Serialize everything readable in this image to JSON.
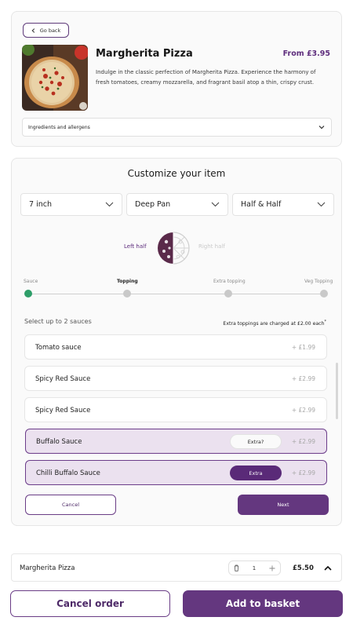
{
  "product": {
    "back_label": "Go back",
    "title": "Margherita Pizza",
    "price": "From £3.95",
    "description": "Indulge in the classic perfection of Margherita Pizza. Experience the harmony of fresh tomatoes, creamy mozzarella, and fragrant basil atop a thin, crispy crust.",
    "ingredients_label": "Ingredients and allergens"
  },
  "customize": {
    "title": "Customize your item",
    "size": "7 inch",
    "crust": "Deep Pan",
    "split": "Half & Half",
    "left_half": "Left half",
    "right_half": "Right half",
    "steps": [
      "Sauce",
      "Topping",
      "Extra topping",
      "Veg Topping"
    ],
    "current_step": "Sauce",
    "sauce_hint": "Select up to 2 sauces",
    "extra_hint": "Extra toppings are charged at £2.00 each",
    "extra_hint_mark": "*",
    "sauces": [
      {
        "name": "Tomato sauce",
        "price": "+ £1.99"
      },
      {
        "name": "Spicy Red Sauce",
        "price": "+ £2.99"
      },
      {
        "name": "Spicy Red Sauce",
        "price": "+ £2.99"
      },
      {
        "name": "Buffalo Sauce",
        "price": "+ £2.99",
        "extra_label": "Extra?"
      },
      {
        "name": "Chilli Buffalo Sauce",
        "price": "+ £2.99",
        "extra_label": "Extra"
      }
    ],
    "cancel_label": "Cancel",
    "next_label": "Next"
  },
  "basket": {
    "item_name": "Margherita Pizza",
    "quantity": "1",
    "price": "£5.50"
  },
  "footer": {
    "cancel_order_label": "Cancel order",
    "add_label": "Add to basket"
  },
  "colors": {
    "brand": "#64377f",
    "selected_bg": "#ebe1ef",
    "step_active": "#2e9e69"
  }
}
